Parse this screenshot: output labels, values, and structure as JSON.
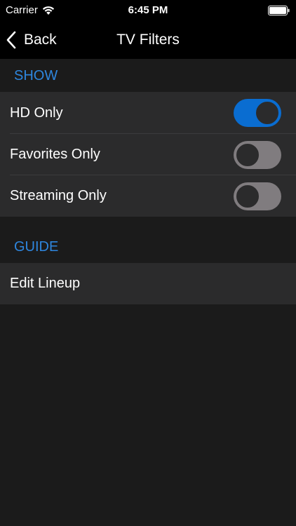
{
  "status_bar": {
    "carrier": "Carrier",
    "time": "6:45 PM",
    "icons": [
      "wifi-icon",
      "battery-icon"
    ]
  },
  "nav": {
    "back_label": "Back",
    "back_icon": "chevron-left-icon",
    "title": "TV Filters"
  },
  "sections": [
    {
      "header": "SHOW",
      "rows": [
        {
          "label": "HD Only",
          "toggle": true
        },
        {
          "label": "Favorites Only",
          "toggle": false
        },
        {
          "label": "Streaming Only",
          "toggle": false
        }
      ]
    },
    {
      "header": "GUIDE",
      "rows": [
        {
          "label": "Edit Lineup"
        }
      ]
    }
  ],
  "colors": {
    "accent": "#2e86de",
    "toggle_on": "#0a6dd1",
    "toggle_off": "#807c7f",
    "row_bg": "#2b2b2c",
    "page_bg": "#1b1b1b",
    "bar_bg": "#000000"
  }
}
